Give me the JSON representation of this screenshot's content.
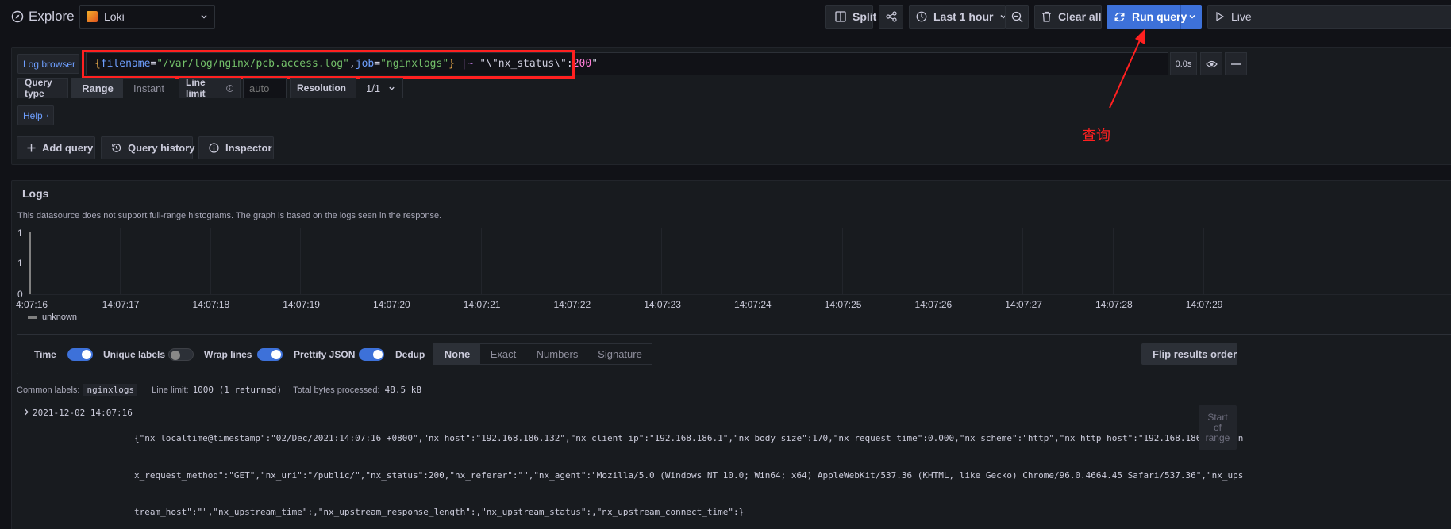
{
  "topbar": {
    "title": "Explore",
    "datasource": "Loki",
    "split": "Split",
    "time_range": "Last 1 hour",
    "clear_all": "Clear all",
    "run_query": "Run query",
    "live": "Live"
  },
  "query": {
    "log_browser": "Log browser",
    "expr": {
      "brace_open": "{",
      "k1": "filename",
      "eq1": "=",
      "v1": "\"/var/log/nginx/pcb.access.log\"",
      "comma": ",",
      "k2": "job",
      "eq2": "=",
      "v2": "\"nginxlogs\"",
      "brace_close": "}",
      "op": " |~ ",
      "str": "\"\\\"nx_status\\\":",
      "num": "200",
      "str_end": "\""
    },
    "time": "0.0s",
    "query_type_label": "Query type",
    "query_types": [
      "Range",
      "Instant"
    ],
    "line_limit_label": "Line limit",
    "line_limit_placeholder": "auto",
    "resolution_label": "Resolution",
    "resolution_value": "1/1",
    "help": "Help",
    "add_query": "Add query",
    "query_history": "Query history",
    "inspector": "Inspector"
  },
  "annotation": {
    "text": "查询",
    "color": "#ff2020"
  },
  "logs": {
    "title": "Logs",
    "notice": "This datasource does not support full-range histograms. The graph is based on the logs seen in the response.",
    "legend": "unknown",
    "options": {
      "time": "Time",
      "unique_labels": "Unique labels",
      "wrap_lines": "Wrap lines",
      "prettify_json": "Prettify JSON",
      "dedup": "Dedup"
    },
    "dedup_options": [
      "None",
      "Exact",
      "Numbers",
      "Signature"
    ],
    "flip": "Flip results order",
    "common_labels_label": "Common labels:",
    "common_labels_value": "nginxlogs",
    "line_limit_label": "Line limit:",
    "line_limit_value": "1000 (1 returned)",
    "bytes_label": "Total bytes processed:",
    "bytes_value": "48.5 kB",
    "row": {
      "timestamp": "2021-12-02 14:07:16",
      "line1": "{\"nx_localtime@timestamp\":\"02/Dec/2021:14:07:16 +0800\",\"nx_host\":\"192.168.186.132\",\"nx_client_ip\":\"192.168.186.1\",\"nx_body_size\":170,\"nx_request_time\":0.000,\"nx_scheme\":\"http\",\"nx_http_host\":\"192.168.186.132\",\"n",
      "line2": "x_request_method\":\"GET\",\"nx_uri\":\"/public/\",\"nx_status\":200,\"nx_referer\":\"\",\"nx_agent\":\"Mozilla/5.0 (Windows NT 10.0; Win64; x64) AppleWebKit/537.36 (KHTML, like Gecko) Chrome/96.0.4664.45 Safari/537.36\",\"nx_ups",
      "line3": "tream_host\":\"\",\"nx_upstream_time\":,\"nx_upstream_response_length\":,\"nx_upstream_status\":,\"nx_upstream_connect_time\":}"
    },
    "start_of_range": [
      "Start",
      "of",
      "range"
    ]
  },
  "chart_data": {
    "type": "bar",
    "title": "",
    "xlabel": "",
    "ylabel": "",
    "y_ticks": [
      "1",
      "1",
      "0"
    ],
    "x_ticks": [
      "4:07:16",
      "14:07:17",
      "14:07:18",
      "14:07:19",
      "14:07:20",
      "14:07:21",
      "14:07:22",
      "14:07:23",
      "14:07:24",
      "14:07:25",
      "14:07:26",
      "14:07:27",
      "14:07:28",
      "14:07:29"
    ],
    "ylim": [
      0,
      1
    ],
    "series": [
      {
        "name": "unknown",
        "x": [
          "14:07:16"
        ],
        "values": [
          1
        ],
        "color": "#808080"
      }
    ]
  }
}
